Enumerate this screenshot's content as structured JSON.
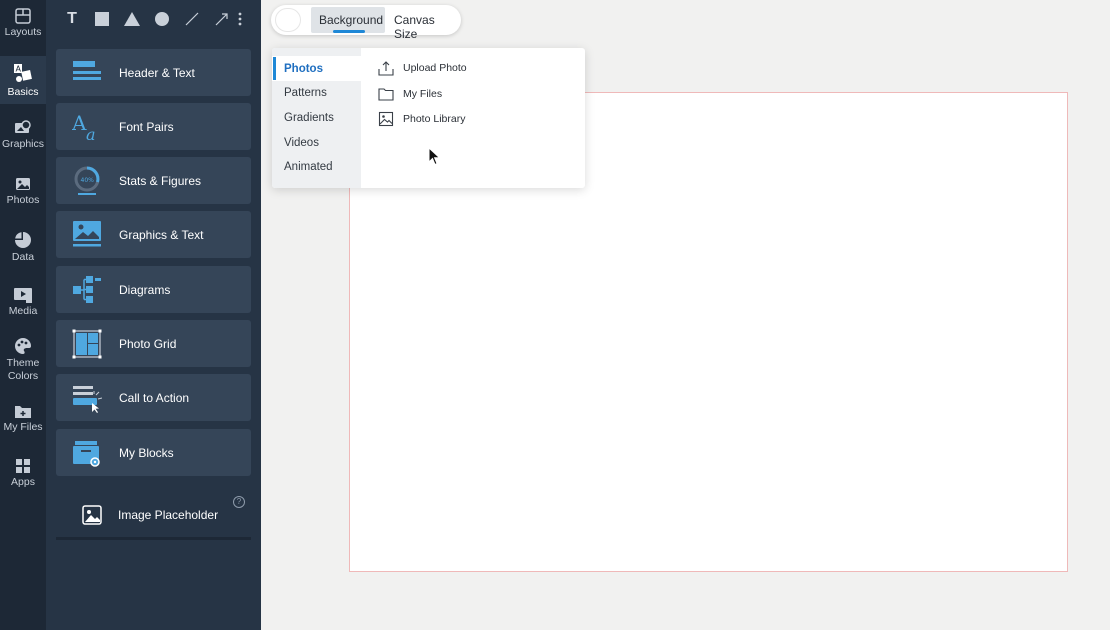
{
  "rail": {
    "items": [
      {
        "label": "Layouts",
        "icon": "layouts-icon"
      },
      {
        "label": "Basics",
        "icon": "basics-icon",
        "active": true
      },
      {
        "label": "Graphics",
        "icon": "graphics-icon"
      },
      {
        "label": "Photos",
        "icon": "photos-icon"
      },
      {
        "label": "Data",
        "icon": "data-icon"
      },
      {
        "label": "Media",
        "icon": "media-icon"
      },
      {
        "label": "Theme Colors",
        "icon": "theme-colors-icon"
      },
      {
        "label": "My Files",
        "icon": "my-files-icon"
      },
      {
        "label": "Apps",
        "icon": "apps-icon"
      }
    ]
  },
  "tools": {
    "text_glyph": "T",
    "items": [
      "text-tool-icon",
      "rectangle-tool-icon",
      "triangle-tool-icon",
      "circle-tool-icon",
      "line-tool-icon",
      "arrow-tool-icon",
      "more-icon"
    ]
  },
  "blocks": [
    {
      "label": "Header & Text",
      "icon": "header-text-icon"
    },
    {
      "label": "Font Pairs",
      "icon": "font-pairs-icon"
    },
    {
      "label": "Stats & Figures",
      "icon": "stats-figures-icon",
      "badge": "40%"
    },
    {
      "label": "Graphics & Text",
      "icon": "graphics-text-icon"
    },
    {
      "label": "Diagrams",
      "icon": "diagrams-icon"
    },
    {
      "label": "Photo Grid",
      "icon": "photo-grid-icon"
    },
    {
      "label": "Call to Action",
      "icon": "call-to-action-icon"
    },
    {
      "label": "My Blocks",
      "icon": "my-blocks-icon"
    }
  ],
  "placeholder": {
    "label": "Image Placeholder",
    "help": "?"
  },
  "topbar": {
    "background_label": "Background",
    "canvas_size_label": "Canvas Size"
  },
  "dropdown": {
    "categories": [
      "Photos",
      "Patterns",
      "Gradients",
      "Videos",
      "Animated"
    ],
    "active_category": "Photos",
    "options": [
      {
        "label": "Upload Photo",
        "icon": "upload-icon"
      },
      {
        "label": "My Files",
        "icon": "folder-icon"
      },
      {
        "label": "Photo Library",
        "icon": "image-icon"
      }
    ]
  },
  "colors": {
    "rail_bg": "#1d2836",
    "panel_bg": "#263445",
    "block_bg": "#354558",
    "accent": "#1f88d6",
    "icon_blue": "#4fa8e0",
    "canvas_border": "#efb9b9"
  }
}
